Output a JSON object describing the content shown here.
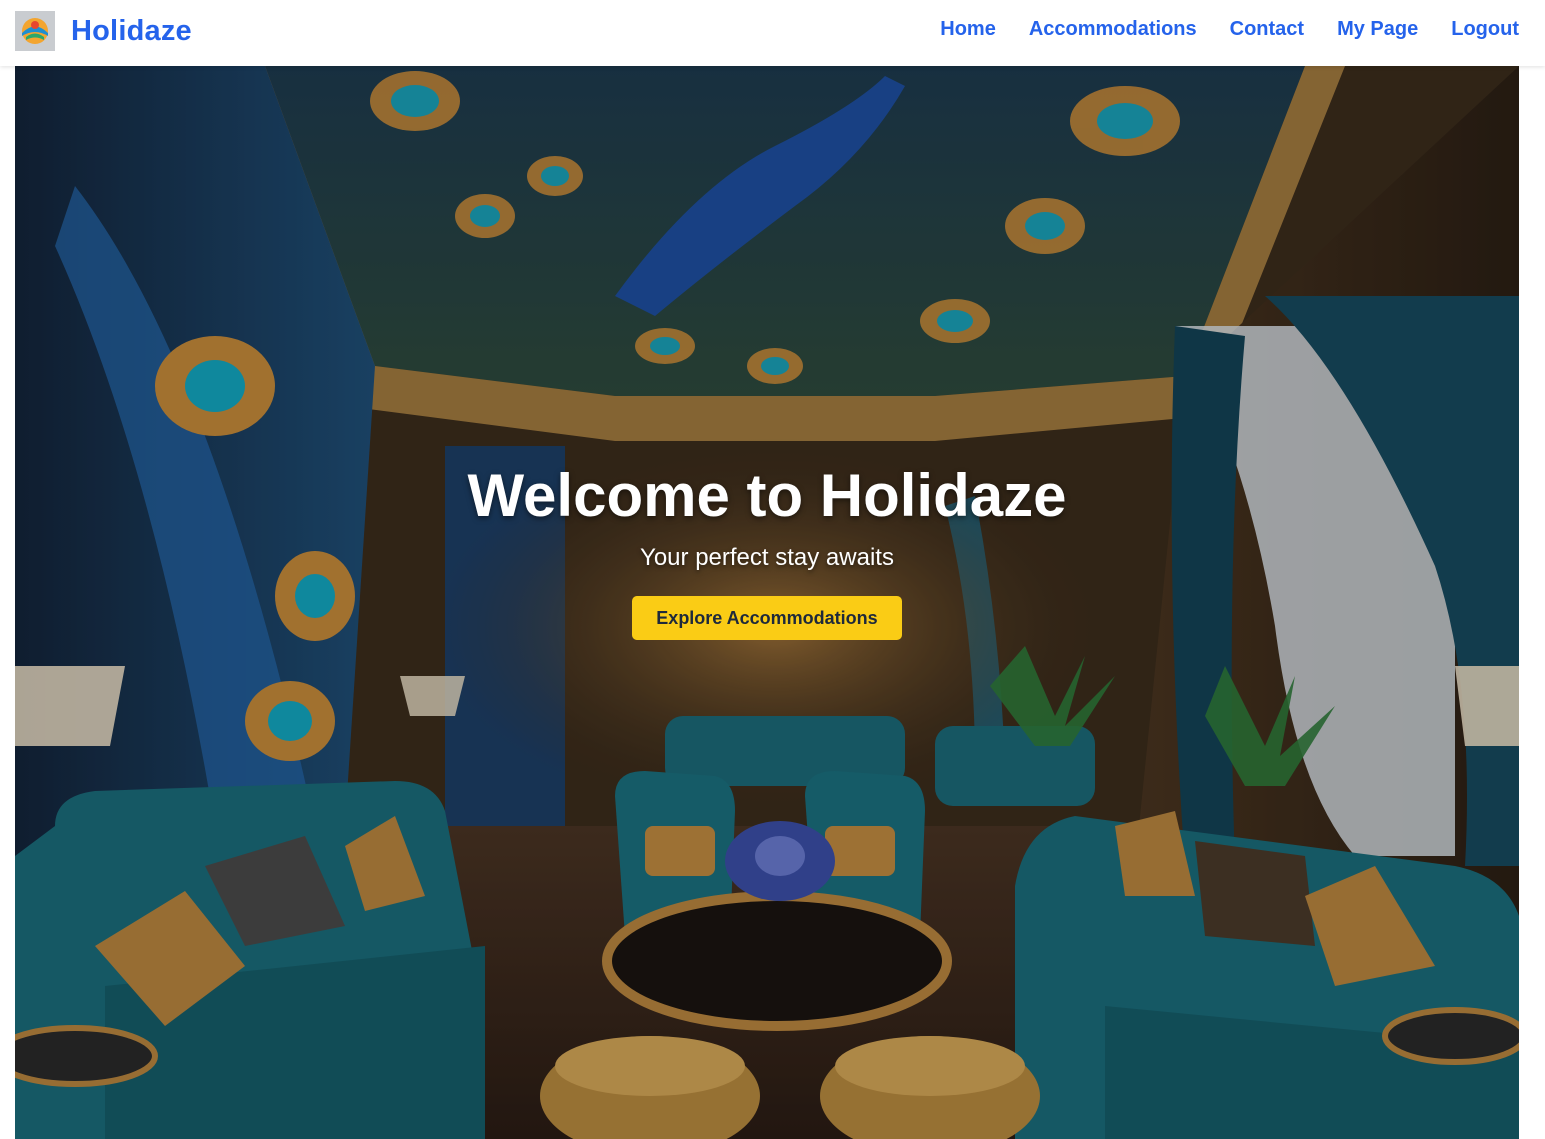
{
  "header": {
    "brand_name": "Holidaze",
    "logo_icon": "holidaze-logo-icon",
    "nav": [
      {
        "label": "Home"
      },
      {
        "label": "Accommodations"
      },
      {
        "label": "Contact"
      },
      {
        "label": "My Page"
      },
      {
        "label": "Logout"
      }
    ]
  },
  "hero": {
    "title": "Welcome to Holidaze",
    "subtitle": "Your perfect stay awaits",
    "cta_label": "Explore Accommodations"
  },
  "colors": {
    "brand": "#2563eb",
    "cta_background": "#facc15",
    "cta_text": "#1e293b"
  }
}
